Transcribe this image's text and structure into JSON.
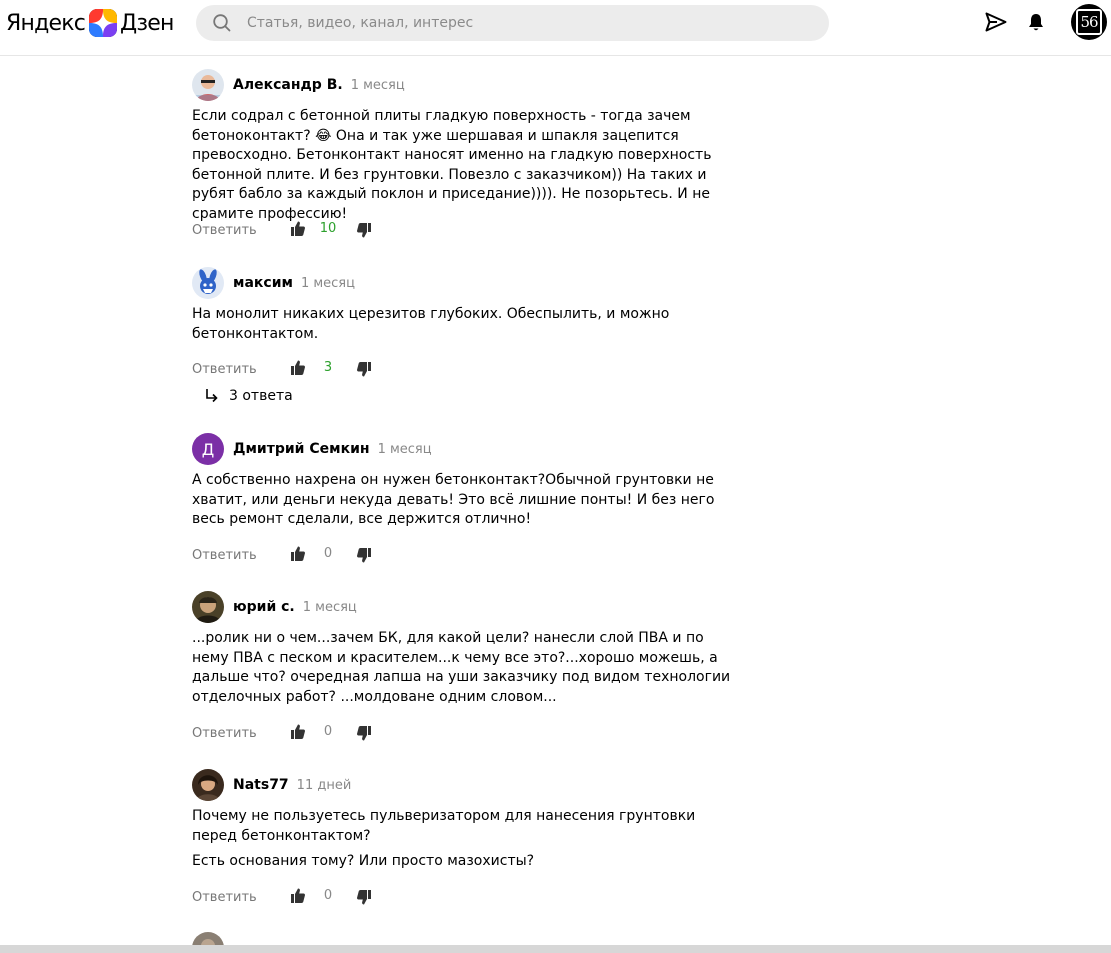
{
  "header": {
    "logo_part1": "Яндекс",
    "logo_part2": "Дзен",
    "search_placeholder": "Статья, видео, канал, интерес",
    "profile_label": "56"
  },
  "comments": [
    {
      "author": "Александр В.",
      "date": "1 месяц",
      "paragraphs": [
        "Если содрал с бетонной плиты гладкую поверхность - тогда зачем бетоноконтакт? 😂 Она и так уже шершавая и шпакля зацепится превосходно. Бетонконтакт наносят именно на гладкую поверхность бетонной плите. И без грунтовки. Повезло с заказчиком)) На таких и рубят бабло за каждый поклон и приседание)))). Не позорьтесь. И не срамите профессию!"
      ],
      "reply_label": "Ответить",
      "likes": "10"
    },
    {
      "author": "максим",
      "date": "1 месяц",
      "paragraphs": [
        "На монолит никаких церезитов глубоких. Обеспылить, и можно бетонконтактом."
      ],
      "reply_label": "Ответить",
      "likes": "3",
      "answers_label": "3 ответа"
    },
    {
      "author": "Дмитрий Семкин",
      "date": "1 месяц",
      "avatar_letter": "Д",
      "paragraphs": [
        "А собственно нахрена он нужен бетонконтакт?Обычной грунтовки не хватит, или деньги некуда девать! Это всё лишние понты! И без него весь ремонт сделали, все держится отлично!"
      ],
      "reply_label": "Ответить",
      "likes": "0"
    },
    {
      "author": "юрий с.",
      "date": "1 месяц",
      "paragraphs": [
        "...ролик ни о чем...зачем БК, для какой цели? нанесли слой ПВА и по нему ПВА с песком и красителем...к чему все это?...хорошо можешь, а дальше что? очередная лапша на уши заказчику под видом технологии отделочных работ? ...молдоване одним словом..."
      ],
      "reply_label": "Ответить",
      "likes": "0"
    },
    {
      "author": "Nats77",
      "date": "11 дней",
      "paragraphs": [
        "Почему не пользуетесь пульверизатором для нанесения грунтовки перед бетонконтактом?",
        "Есть основания тому? Или просто мазохисты?"
      ],
      "reply_label": "Ответить",
      "likes": "0"
    }
  ],
  "colors": {
    "likes_positive": "#2ca02c",
    "likes_zero": "#888888",
    "avatar_purple": "#7b2fa6",
    "search_bg": "#ececec"
  }
}
